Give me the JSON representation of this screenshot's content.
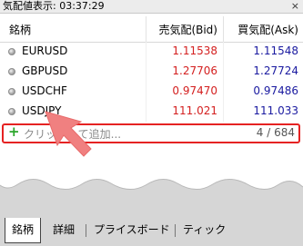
{
  "window": {
    "title": "気配値表示: 03:37:29",
    "close": "×"
  },
  "columns": {
    "symbol": "銘柄",
    "bid": "売気配(Bid)",
    "ask": "買気配(Ask)"
  },
  "rows": [
    {
      "symbol": "EURUSD",
      "bid": "1.11538",
      "ask": "1.11548"
    },
    {
      "symbol": "GBPUSD",
      "bid": "1.27706",
      "ask": "1.27724"
    },
    {
      "symbol": "USDCHF",
      "bid": "0.97470",
      "ask": "0.97486"
    },
    {
      "symbol": "USDJPY",
      "bid": "111.021",
      "ask": "111.033"
    }
  ],
  "add_row": {
    "placeholder": "クリックして追加...",
    "count": "4 / 684"
  },
  "tabs": [
    "銘柄",
    "詳細",
    "プライスボード",
    "ティック"
  ],
  "colors": {
    "bid": "#d42020",
    "ask": "#1a1aa0",
    "highlight": "#e52222",
    "plus": "#2aa52a",
    "arrow": "#f08080"
  },
  "icons": {
    "close": "close-icon",
    "plus": "plus-icon",
    "row_marker": "circle-icon",
    "pointer": "pointer-arrow-icon"
  }
}
